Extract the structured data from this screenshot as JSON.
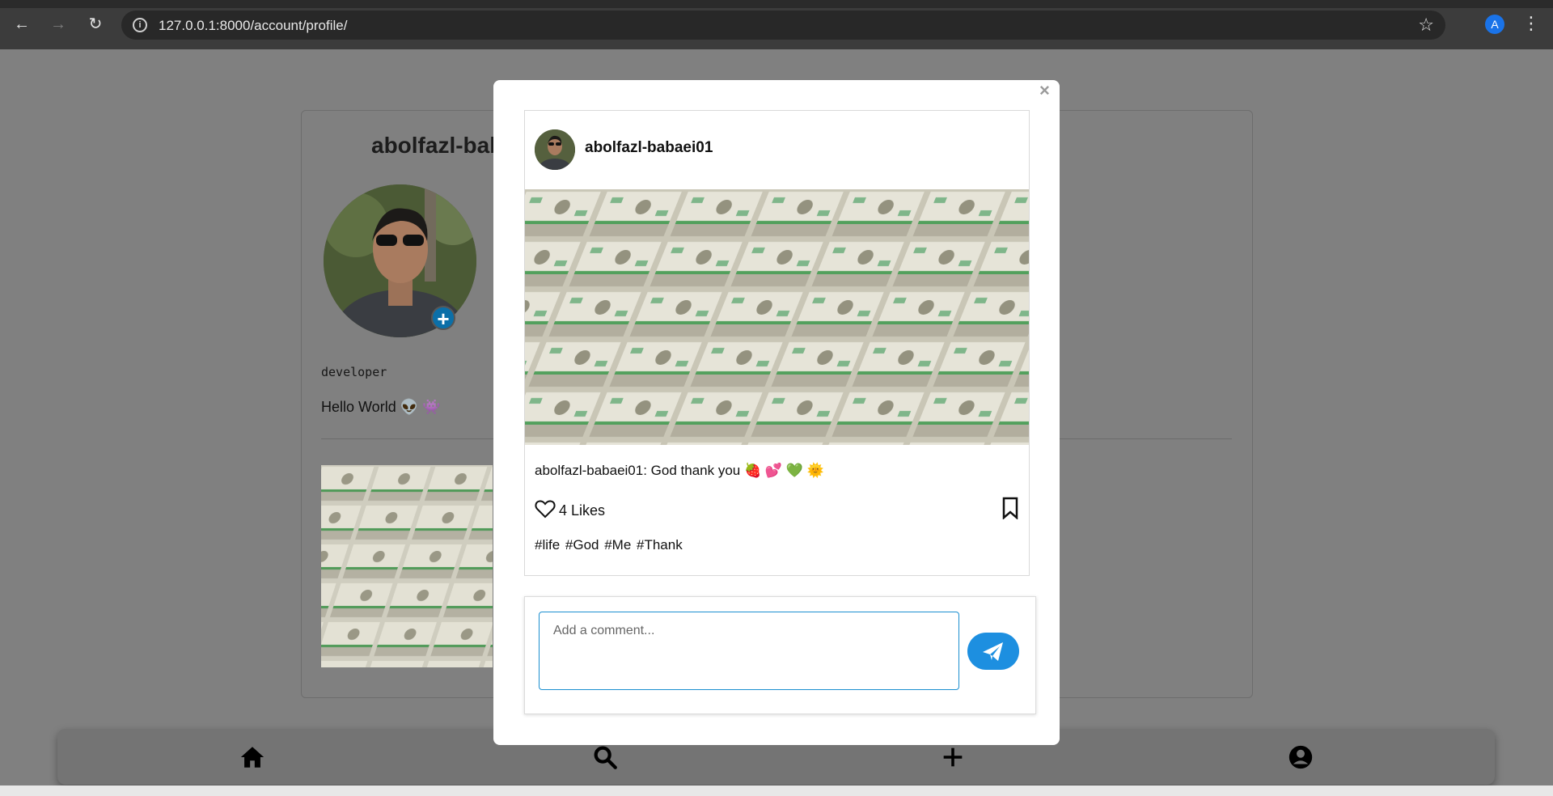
{
  "browser": {
    "url": "127.0.0.1:8000/account/profile/",
    "profile_initial": "A",
    "icons": [
      "back-icon",
      "forward-icon",
      "reload-icon",
      "site-info-icon",
      "bookmark-star-icon",
      "menu-kebab-icon"
    ]
  },
  "profile": {
    "username": "abolfazl-bab",
    "job": "developer",
    "bio": "Hello World 👽 👾",
    "add_avatar_label": "+"
  },
  "modal": {
    "close_label": "×",
    "post": {
      "username": "abolfazl-babaei01",
      "caption": "abolfazl-babaei01: God thank you 🍓 💕 💚 🌞",
      "likes": "4 Likes",
      "tags": "#life #God #Me #Thank"
    },
    "comment": {
      "placeholder": "Add a comment..."
    }
  },
  "bottom_nav": {
    "items": [
      "home-icon",
      "search-icon",
      "add-icon",
      "profile-icon"
    ]
  },
  "colors": {
    "overlay": "#808080",
    "accent": "#1d8fe0",
    "modal_bg": "#ffffff"
  }
}
